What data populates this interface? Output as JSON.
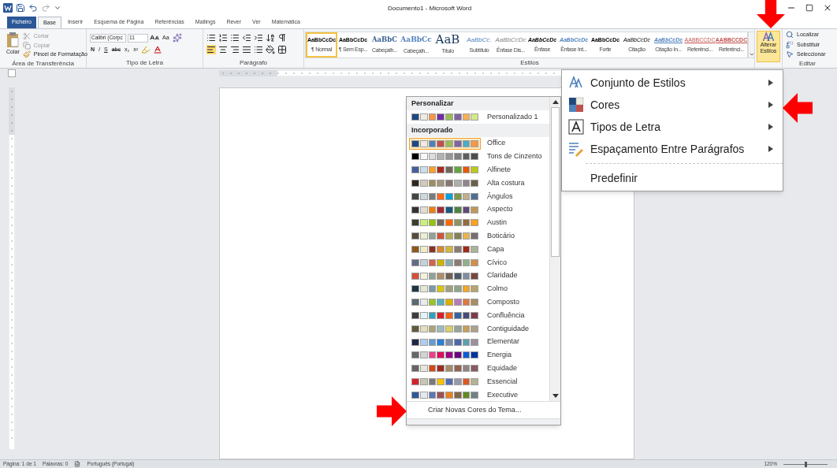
{
  "window": {
    "title": "Documento1 - Microsoft Word"
  },
  "tabs": [
    {
      "label": "Ficheiro",
      "kind": "file",
      "selected": false
    },
    {
      "label": "Base",
      "kind": "tab",
      "selected": true
    },
    {
      "label": "Inserir",
      "kind": "tab",
      "selected": false
    },
    {
      "label": "Esquema de Página",
      "kind": "tab",
      "selected": false
    },
    {
      "label": "Referências",
      "kind": "tab",
      "selected": false
    },
    {
      "label": "Mailings",
      "kind": "tab",
      "selected": false
    },
    {
      "label": "Rever",
      "kind": "tab",
      "selected": false
    },
    {
      "label": "Ver",
      "kind": "tab",
      "selected": false
    },
    {
      "label": "Matemática",
      "kind": "tab",
      "selected": false
    }
  ],
  "ribbon": {
    "clipboard": {
      "paste": "Colar",
      "items": [
        "Cortar",
        "Copiar",
        "Pincel de Formatação"
      ],
      "label": "Área de Transferência"
    },
    "font": {
      "name": "Calibri (Corpc",
      "size": "11",
      "case_button": "Aa",
      "format_buttons": [
        "N",
        "I",
        "S",
        "abc",
        "x₂",
        "x²"
      ],
      "label": "Tipo de Letra"
    },
    "paragraph": {
      "label": "Parágrafo"
    },
    "styles": {
      "label": "Estilos",
      "items": [
        {
          "sample": "AaBbCcDc",
          "label": "¶ Normal",
          "kind": "normal",
          "selected": true
        },
        {
          "sample": "AaBbCcDc",
          "label": "¶ Sem Esp...",
          "kind": "normal",
          "selected": false
        },
        {
          "sample": "AaBbC",
          "label": "Cabeçalh...",
          "kind": "heading1",
          "selected": false
        },
        {
          "sample": "AaBbCc",
          "label": "Cabeçalh...",
          "kind": "heading2",
          "selected": false
        },
        {
          "sample": "AaB",
          "label": "Título",
          "kind": "title",
          "selected": false
        },
        {
          "sample": "AaBbCc.",
          "label": "Subtítulo",
          "kind": "subtitle",
          "selected": false
        },
        {
          "sample": "AaBbCcDc",
          "label": "Ênfase Dis...",
          "kind": "subtle",
          "selected": false
        },
        {
          "sample": "AaBbCcDc",
          "label": "Ênfase",
          "kind": "emphasis",
          "selected": false
        },
        {
          "sample": "AaBbCcDc",
          "label": "Ênfase Int...",
          "kind": "intense",
          "selected": false
        },
        {
          "sample": "AaBbCcDc",
          "label": "Forte",
          "kind": "strong",
          "selected": false
        },
        {
          "sample": "AaBbCcDc",
          "label": "Citação",
          "kind": "quote",
          "selected": false
        },
        {
          "sample": "AaBbCcDc",
          "label": "Citação In...",
          "kind": "intense_quote",
          "selected": false
        },
        {
          "sample": "AABBCCDC",
          "label": "Referênci...",
          "kind": "reference",
          "selected": false
        },
        {
          "sample": "AABBCCDC",
          "label": "Referênci...",
          "kind": "reference_strong",
          "selected": false
        }
      ]
    },
    "change_styles": {
      "label": "Alterar Estilos",
      "active": true
    },
    "editing": {
      "items": [
        "Localizar",
        "Substituir",
        "Seleccionar"
      ],
      "label": "Editar"
    }
  },
  "side_menu": {
    "items": [
      {
        "label": "Conjunto de Estilos",
        "kind": "styles",
        "submenu": true
      },
      {
        "label": "Cores",
        "kind": "colors",
        "submenu": true
      },
      {
        "label": "Tipos de Letra",
        "kind": "fonts",
        "submenu": true
      },
      {
        "label": "Espaçamento Entre Parágrafos",
        "kind": "spacing",
        "submenu": true
      },
      {
        "label": "Predefinir",
        "kind": "reset",
        "submenu": false
      }
    ]
  },
  "colors_menu": {
    "sections": [
      {
        "title": "Personalizar",
        "themes": [
          {
            "name": "Personalizado 1",
            "selected": false,
            "swatches": [
              {
                "color": "#1f497d"
              },
              {
                "color": "#eeece1"
              },
              {
                "color": "#f79646"
              },
              {
                "color": "#7030a0"
              },
              {
                "color": "#9bbb59"
              },
              {
                "color": "#8064a2"
              },
              {
                "color": "#f9b050"
              },
              {
                "color": "#d4e88a"
              }
            ]
          }
        ]
      },
      {
        "title": "Incorporado",
        "themes": [
          {
            "name": "Office",
            "selected": true,
            "swatches": [
              {
                "color": "#1f497d"
              },
              {
                "color": "#eeece1"
              },
              {
                "color": "#4f81bd"
              },
              {
                "color": "#c0504d"
              },
              {
                "color": "#9bbb59"
              },
              {
                "color": "#8064a2"
              },
              {
                "color": "#4bacc6"
              },
              {
                "color": "#f79646"
              }
            ]
          },
          {
            "name": "Tons de Cinzento",
            "selected": false,
            "swatches": [
              {
                "color": "#000000"
              },
              {
                "color": "#f8f8f8"
              },
              {
                "color": "#dddddd"
              },
              {
                "color": "#b2b2b2"
              },
              {
                "color": "#969696"
              },
              {
                "color": "#808080"
              },
              {
                "color": "#5f5f5f"
              },
              {
                "color": "#4d4d4d"
              }
            ]
          },
          {
            "name": "Alfinete",
            "selected": false,
            "swatches": [
              {
                "color": "#465e9c"
              },
              {
                "color": "#ccddea"
              },
              {
                "color": "#fda023"
              },
              {
                "color": "#aa2b1e"
              },
              {
                "color": "#71685c"
              },
              {
                "color": "#64a73b"
              },
              {
                "color": "#eb5605"
              },
              {
                "color": "#b9ca1a"
              }
            ]
          },
          {
            "name": "Alta costura",
            "selected": false,
            "swatches": [
              {
                "color": "#31261d"
              },
              {
                "color": "#d1cbb8"
              },
              {
                "color": "#9e8e5c"
              },
              {
                "color": "#a09781"
              },
              {
                "color": "#85776d"
              },
              {
                "color": "#aeafa9"
              },
              {
                "color": "#8d878b"
              },
              {
                "color": "#6b6149"
              }
            ]
          },
          {
            "name": "Ângulos",
            "selected": false,
            "swatches": [
              {
                "color": "#434342"
              },
              {
                "color": "#cdd7d9"
              },
              {
                "color": "#797b7e"
              },
              {
                "color": "#f96a1b"
              },
              {
                "color": "#08a1d9"
              },
              {
                "color": "#7c984a"
              },
              {
                "color": "#c2ad8d"
              },
              {
                "color": "#506e94"
              }
            ]
          },
          {
            "name": "Aspecto",
            "selected": false,
            "swatches": [
              {
                "color": "#323232"
              },
              {
                "color": "#e3ded1"
              },
              {
                "color": "#f07f09"
              },
              {
                "color": "#9f2936"
              },
              {
                "color": "#1b587c"
              },
              {
                "color": "#4e8542"
              },
              {
                "color": "#604878"
              },
              {
                "color": "#c19859"
              }
            ]
          },
          {
            "name": "Austin",
            "selected": false,
            "swatches": [
              {
                "color": "#3e3d2d"
              },
              {
                "color": "#caf278"
              },
              {
                "color": "#94c600"
              },
              {
                "color": "#71685a"
              },
              {
                "color": "#ff6700"
              },
              {
                "color": "#909465"
              },
              {
                "color": "#956b43"
              },
              {
                "color": "#fea022"
              }
            ]
          },
          {
            "name": "Boticário",
            "selected": false,
            "swatches": [
              {
                "color": "#564b3c"
              },
              {
                "color": "#ecedd1"
              },
              {
                "color": "#93a299"
              },
              {
                "color": "#cf543f"
              },
              {
                "color": "#b5ae53"
              },
              {
                "color": "#848058"
              },
              {
                "color": "#e8b54d"
              },
              {
                "color": "#786c71"
              }
            ]
          },
          {
            "name": "Capa",
            "selected": false,
            "swatches": [
              {
                "color": "#8b5a1a"
              },
              {
                "color": "#f0ebc8"
              },
              {
                "color": "#8b3125"
              },
              {
                "color": "#d8882f"
              },
              {
                "color": "#cfb83c"
              },
              {
                "color": "#8c7b70"
              },
              {
                "color": "#9e2b16"
              },
              {
                "color": "#a9b497"
              }
            ]
          },
          {
            "name": "Cívico",
            "selected": false,
            "swatches": [
              {
                "color": "#646b86"
              },
              {
                "color": "#c5d1d7"
              },
              {
                "color": "#d16349"
              },
              {
                "color": "#ccb400"
              },
              {
                "color": "#8cadae"
              },
              {
                "color": "#8c7b70"
              },
              {
                "color": "#8fb08c"
              },
              {
                "color": "#d19049"
              }
            ]
          },
          {
            "name": "Claridade",
            "selected": false,
            "swatches": [
              {
                "color": "#d5503a"
              },
              {
                "color": "#f3f2dc"
              },
              {
                "color": "#93a299"
              },
              {
                "color": "#ad8f67"
              },
              {
                "color": "#726056"
              },
              {
                "color": "#4c5a6a"
              },
              {
                "color": "#808da0"
              },
              {
                "color": "#79463d"
              }
            ]
          },
          {
            "name": "Colmo",
            "selected": false,
            "swatches": [
              {
                "color": "#1f3540"
              },
              {
                "color": "#e3e8d2"
              },
              {
                "color": "#7a9aa8"
              },
              {
                "color": "#d5c615"
              },
              {
                "color": "#a19f7d"
              },
              {
                "color": "#8fa78b"
              },
              {
                "color": "#f5a623"
              },
              {
                "color": "#b8a56c"
              }
            ]
          },
          {
            "name": "Composto",
            "selected": false,
            "swatches": [
              {
                "color": "#5b6973"
              },
              {
                "color": "#e7ecec"
              },
              {
                "color": "#98c723"
              },
              {
                "color": "#59b0b9"
              },
              {
                "color": "#deae00"
              },
              {
                "color": "#b77bb4"
              },
              {
                "color": "#e0773c"
              },
              {
                "color": "#a98d63"
              }
            ]
          },
          {
            "name": "Confluência",
            "selected": false,
            "swatches": [
              {
                "color": "#3c3c3c"
              },
              {
                "color": "#e0f4f9"
              },
              {
                "color": "#2da2bf"
              },
              {
                "color": "#da1f28"
              },
              {
                "color": "#eb641b"
              },
              {
                "color": "#39639d"
              },
              {
                "color": "#474b78"
              },
              {
                "color": "#7d3c4a"
              }
            ]
          },
          {
            "name": "Contiguidade",
            "selected": false,
            "swatches": [
              {
                "color": "#605b3f"
              },
              {
                "color": "#e3dfbb"
              },
              {
                "color": "#aba477"
              },
              {
                "color": "#a0babc"
              },
              {
                "color": "#d8cf6b"
              },
              {
                "color": "#96a599"
              },
              {
                "color": "#c79f5a"
              },
              {
                "color": "#b0a18a"
              }
            ]
          },
          {
            "name": "Elementar",
            "selected": false,
            "swatches": [
              {
                "color": "#212745"
              },
              {
                "color": "#b0ccf0"
              },
              {
                "color": "#629dd1"
              },
              {
                "color": "#297fd5"
              },
              {
                "color": "#7f8fa9"
              },
              {
                "color": "#4a66ac"
              },
              {
                "color": "#5aa2ae"
              },
              {
                "color": "#9d90a0"
              }
            ]
          },
          {
            "name": "Energia",
            "selected": false,
            "swatches": [
              {
                "color": "#666666"
              },
              {
                "color": "#d3d3d3"
              },
              {
                "color": "#ee3f8a"
              },
              {
                "color": "#dc0f5a"
              },
              {
                "color": "#9c0087"
              },
              {
                "color": "#6a0083"
              },
              {
                "color": "#0b5cd6"
              },
              {
                "color": "#00339b"
              }
            ]
          },
          {
            "name": "Equidade",
            "selected": false,
            "swatches": [
              {
                "color": "#696464"
              },
              {
                "color": "#e9e5dc"
              },
              {
                "color": "#d34817"
              },
              {
                "color": "#9b2d1f"
              },
              {
                "color": "#a28e6a"
              },
              {
                "color": "#956251"
              },
              {
                "color": "#918485"
              },
              {
                "color": "#855d5d"
              }
            ]
          },
          {
            "name": "Essencial",
            "selected": false,
            "swatches": [
              {
                "color": "#d4232e"
              },
              {
                "color": "#c7c6b0"
              },
              {
                "color": "#7a7a7a"
              },
              {
                "color": "#f5c201"
              },
              {
                "color": "#526db0"
              },
              {
                "color": "#989aac"
              },
              {
                "color": "#dc5924"
              },
              {
                "color": "#b4b392"
              }
            ]
          },
          {
            "name": "Executive",
            "selected": false,
            "swatches": [
              {
                "color": "#2f5897"
              },
              {
                "color": "#e4e9ef"
              },
              {
                "color": "#6076b4"
              },
              {
                "color": "#9c5252"
              },
              {
                "color": "#e68422"
              },
              {
                "color": "#846648"
              },
              {
                "color": "#63891f"
              },
              {
                "color": "#758085"
              }
            ]
          }
        ]
      }
    ],
    "footer": "Criar Novas Cores do Tema..."
  },
  "status_bar": {
    "page": "Página: 1 de 1",
    "words": "Palavras: 0",
    "language": "Português (Portugal)",
    "zoom": "120%",
    "zoom_slider": {
      "level": 0.5
    }
  }
}
